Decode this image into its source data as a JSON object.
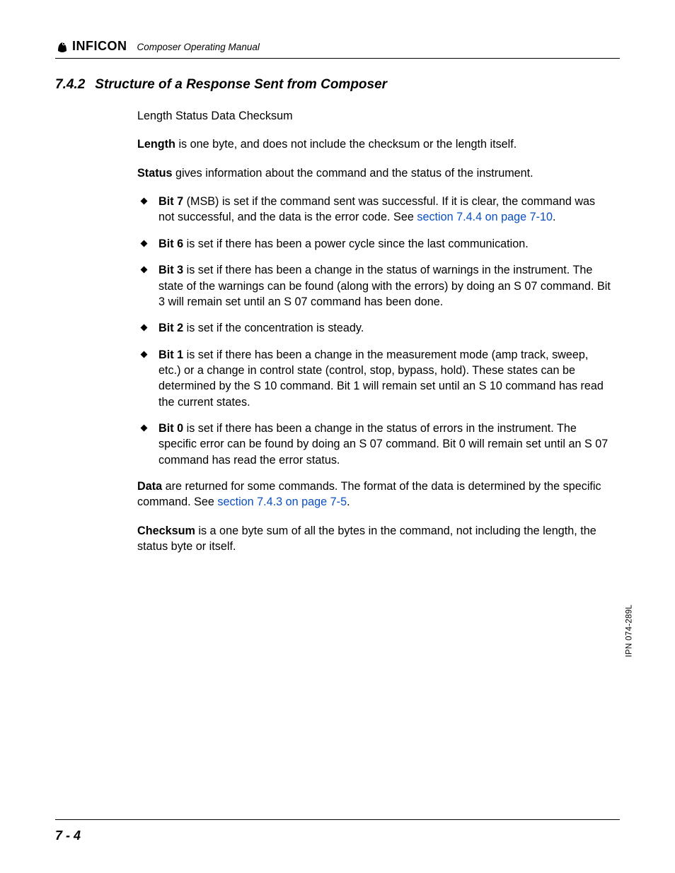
{
  "header": {
    "brand_word": "INFICON",
    "doc_title": "Composer Operating Manual"
  },
  "section": {
    "number": "7.4.2",
    "title": "Structure of a Response Sent from Composer"
  },
  "intro_line": "Length Status Data Checksum",
  "length_para": {
    "bold": "Length",
    "rest": " is one byte, and does not include the checksum or the length itself."
  },
  "status_para": {
    "bold": "Status",
    "rest": " gives information about the command and the status of the instrument."
  },
  "bits": [
    {
      "label": "Bit 7",
      "before_link": " (MSB) is set if the command sent was successful. If it is clear, the command was not successful, and the data is the error code. See ",
      "link_text": "section 7.4.4 on page 7-10",
      "after_link": "."
    },
    {
      "label": "Bit 6",
      "text": " is set if there has been a power cycle since the last communication."
    },
    {
      "label": "Bit 3",
      "text": " is set if there has been a change in the status of warnings in the instrument. The state of the warnings can be found (along with the errors) by doing an S 07 command. Bit 3 will remain set until an S 07 command has been done."
    },
    {
      "label": "Bit 2",
      "text": " is set if the concentration is steady."
    },
    {
      "label": "Bit 1",
      "text": " is set if there has been a change in the measurement mode (amp track, sweep, etc.) or a change in control state (control, stop, bypass, hold). These states can be determined by the S 10 command. Bit 1 will remain set until an S 10 command has read the current states."
    },
    {
      "label": "Bit 0",
      "text": " is set if there has been a change in the status of errors in the instrument. The specific error can be found by doing an S 07 command. Bit 0 will remain set until an S 07 command has read the error status."
    }
  ],
  "data_para": {
    "bold": "Data",
    "before_link": " are returned for some commands. The format of the data is determined by the specific command. See ",
    "link_text": "section 7.4.3 on page 7-5",
    "after_link": "."
  },
  "checksum_para": {
    "bold": "Checksum",
    "rest": " is a one byte sum of all the bytes in the command, not including the length, the status byte or itself."
  },
  "side_code": "IPN 074-289L",
  "footer": {
    "page_number": "7 - 4"
  }
}
